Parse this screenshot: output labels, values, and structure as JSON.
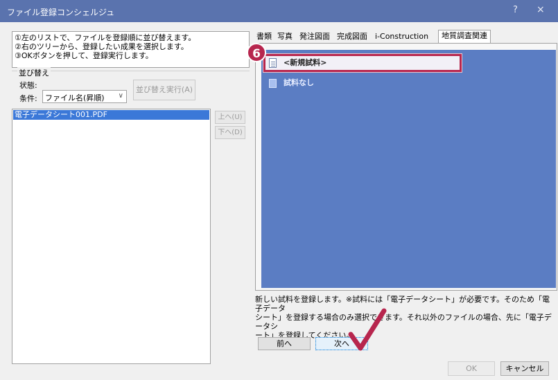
{
  "window": {
    "title": "ファイル登録コンシェルジュ",
    "help_glyph": "?",
    "close_glyph": "×"
  },
  "instructions": [
    "①左のリストで、ファイルを登録順に並び替えます。",
    "②右のツリーから、登録したい成果を選択します。",
    "③OKボタンを押して、登録実行します。"
  ],
  "sort": {
    "group_label": "並び替え",
    "state_label": "状態:",
    "condition_label": "条件:",
    "condition_value": "ファイル名(昇順)",
    "execute_label": "並び替え実行(A)"
  },
  "file_list": {
    "items": [
      "電子データシート001.PDF"
    ]
  },
  "move_buttons": {
    "up_label": "上へ(U)",
    "down_label": "下へ(D)"
  },
  "tabs": [
    {
      "label": "書類",
      "active": false
    },
    {
      "label": "写真",
      "active": false
    },
    {
      "label": "発注図面",
      "active": false
    },
    {
      "label": "完成図面",
      "active": false
    },
    {
      "label": "i-Construction",
      "active": false
    },
    {
      "label": "地質調査関連",
      "active": true
    }
  ],
  "tree": {
    "items": [
      {
        "label": "<新規試料>",
        "icon": "document-icon",
        "selected": true
      },
      {
        "label": "試料なし",
        "icon": "sample-icon",
        "selected": false
      }
    ]
  },
  "step_badge": "6",
  "description": [
    "新しい試料を登録します。※試料には「電子データシート」が必要です。そのため「電子データ",
    "シート」を登録する場合のみ選択できます。それ以外のファイルの場合、先に「電子データシ",
    "ート」を登録してください。"
  ],
  "nav": {
    "prev_label": "前へ",
    "next_label": "次へ"
  },
  "footer": {
    "ok_label": "OK",
    "cancel_label": "キャンセル"
  },
  "colors": {
    "titlebar": "#5a73ae",
    "tree_background": "#5b7dc3",
    "highlight": "#b7264e",
    "list_selection": "#3b78d8"
  }
}
